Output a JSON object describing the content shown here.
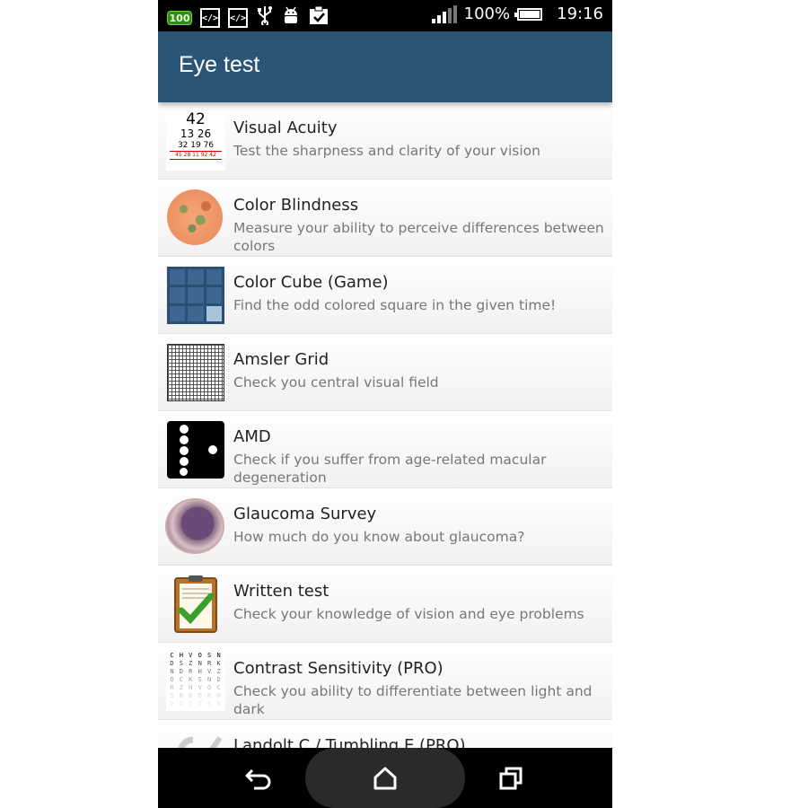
{
  "status_bar": {
    "notification_badge": "100",
    "battery_percent": "100%",
    "time": "19:16",
    "icons": [
      "battery-100-notification-icon",
      "code-icon",
      "code-icon",
      "usb-icon",
      "android-icon",
      "clipboard-check-icon",
      "signal-icon",
      "battery-icon"
    ]
  },
  "app_bar": {
    "title": "Eye test"
  },
  "items": [
    {
      "title": "Visual Acuity",
      "subtitle": "Test the sharpness and clarity of your vision",
      "thumb_lines": [
        "42",
        "13 26",
        "32 19 76",
        "45 28 11 92 42"
      ]
    },
    {
      "title": "Color Blindness",
      "subtitle": "Measure your ability to perceive differences between colors"
    },
    {
      "title": "Color Cube (Game)",
      "subtitle": "Find the odd colored square in the given time!"
    },
    {
      "title": "Amsler Grid",
      "subtitle": "Check you central visual field"
    },
    {
      "title": "AMD",
      "subtitle": "Check if you suffer from age-related macular degeneration"
    },
    {
      "title": "Glaucoma Survey",
      "subtitle": "How much do you know about glaucoma?"
    },
    {
      "title": "Written test",
      "subtitle": "Check your knowledge of vision and eye problems"
    },
    {
      "title": "Contrast Sensitivity (PRO)",
      "subtitle": "Check you ability to differentiate between light and dark",
      "thumb_lines": [
        "C H V O S N",
        "D S Z N R K",
        "N D R H V Z",
        "O C K S N D",
        "R Z H V O C",
        "S N K D R H",
        "V O C Z S N"
      ]
    },
    {
      "title": "Landolt C / Tumbling E (PRO)",
      "subtitle": ""
    }
  ],
  "nav_bar": {
    "icons": [
      "back-icon",
      "home-icon",
      "recent-apps-icon"
    ]
  },
  "colors": {
    "app_bar": "#2a5577",
    "status_bar": "#000000",
    "nav_bar": "#000000",
    "cube_dark": "#3d6690",
    "cube_odd": "#a8c4dc"
  }
}
